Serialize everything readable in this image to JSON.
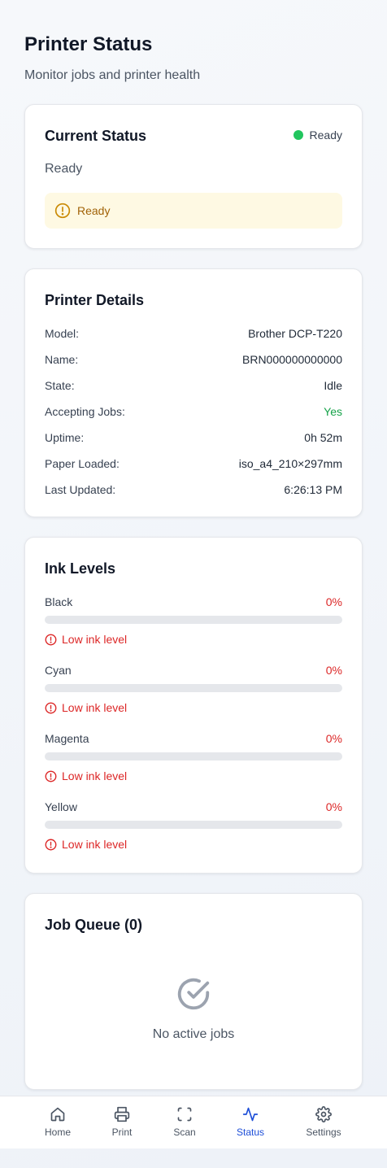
{
  "header": {
    "title": "Printer Status",
    "subtitle": "Monitor jobs and printer health"
  },
  "current_status": {
    "title": "Current Status",
    "indicator_label": "Ready",
    "indicator_color": "#22c55e",
    "status_text": "Ready",
    "alert_text": "Ready",
    "alert_bg": "#fef9e3",
    "alert_color": "#a16207"
  },
  "details": {
    "title": "Printer Details",
    "rows": [
      {
        "label": "Model:",
        "value": "Brother DCP-T220"
      },
      {
        "label": "Name:",
        "value": "BRN000000000000"
      },
      {
        "label": "State:",
        "value": "Idle"
      },
      {
        "label": "Accepting Jobs:",
        "value": "Yes"
      },
      {
        "label": "Uptime:",
        "value": "0h 52m"
      },
      {
        "label": "Paper Loaded:",
        "value": "iso_a4_210×297mm"
      },
      {
        "label": "Last Updated:",
        "value": "6:26:13 PM"
      }
    ],
    "positive_color": "#16a34a"
  },
  "ink": {
    "title": "Ink Levels",
    "items": [
      {
        "name": "Black",
        "percent_label": "0%",
        "level": 0,
        "warning": "Low ink level"
      },
      {
        "name": "Cyan",
        "percent_label": "0%",
        "level": 0,
        "warning": "Low ink level"
      },
      {
        "name": "Magenta",
        "percent_label": "0%",
        "level": 0,
        "warning": "Low ink level"
      },
      {
        "name": "Yellow",
        "percent_label": "0%",
        "level": 0,
        "warning": "Low ink level"
      }
    ],
    "warning_color": "#dc2626"
  },
  "jobs": {
    "title": "Job Queue (0)",
    "empty_text": "No active jobs",
    "empty_icon": "check-circle-icon"
  },
  "nav": {
    "active_color": "#1d4ed8",
    "items": [
      {
        "label": "Home",
        "icon": "home-icon"
      },
      {
        "label": "Print",
        "icon": "printer-icon"
      },
      {
        "label": "Scan",
        "icon": "scan-icon"
      },
      {
        "label": "Status",
        "icon": "activity-icon",
        "active": true
      },
      {
        "label": "Settings",
        "icon": "gear-icon"
      }
    ]
  }
}
